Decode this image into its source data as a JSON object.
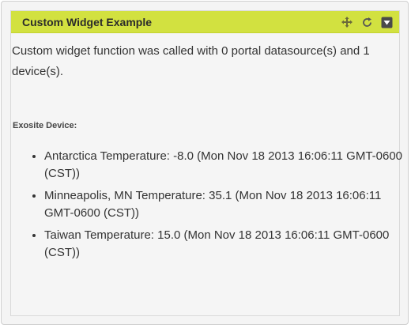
{
  "widget": {
    "title": "Custom Widget Example",
    "tools": [
      {
        "name": "move-icon"
      },
      {
        "name": "refresh-icon"
      },
      {
        "name": "collapse-icon"
      }
    ]
  },
  "content": {
    "intro": "Custom widget function was called with 0 portal datasource(s) and 1 device(s).",
    "device_label": "Exosite Device:",
    "devices": [
      "Antarctica Temperature: -8.0 (Mon Nov 18 2013 16:06:11 GMT-0600 (CST))",
      "Minneapolis, MN Temperature: 35.1 (Mon Nov 18 2013 16:06:11 GMT-0600 (CST))",
      "Taiwan Temperature: 15.0 (Mon Nov 18 2013 16:06:11 GMT-0600 (CST))"
    ]
  },
  "colors": {
    "header_bg": "#d2e140",
    "text": "#333333"
  }
}
